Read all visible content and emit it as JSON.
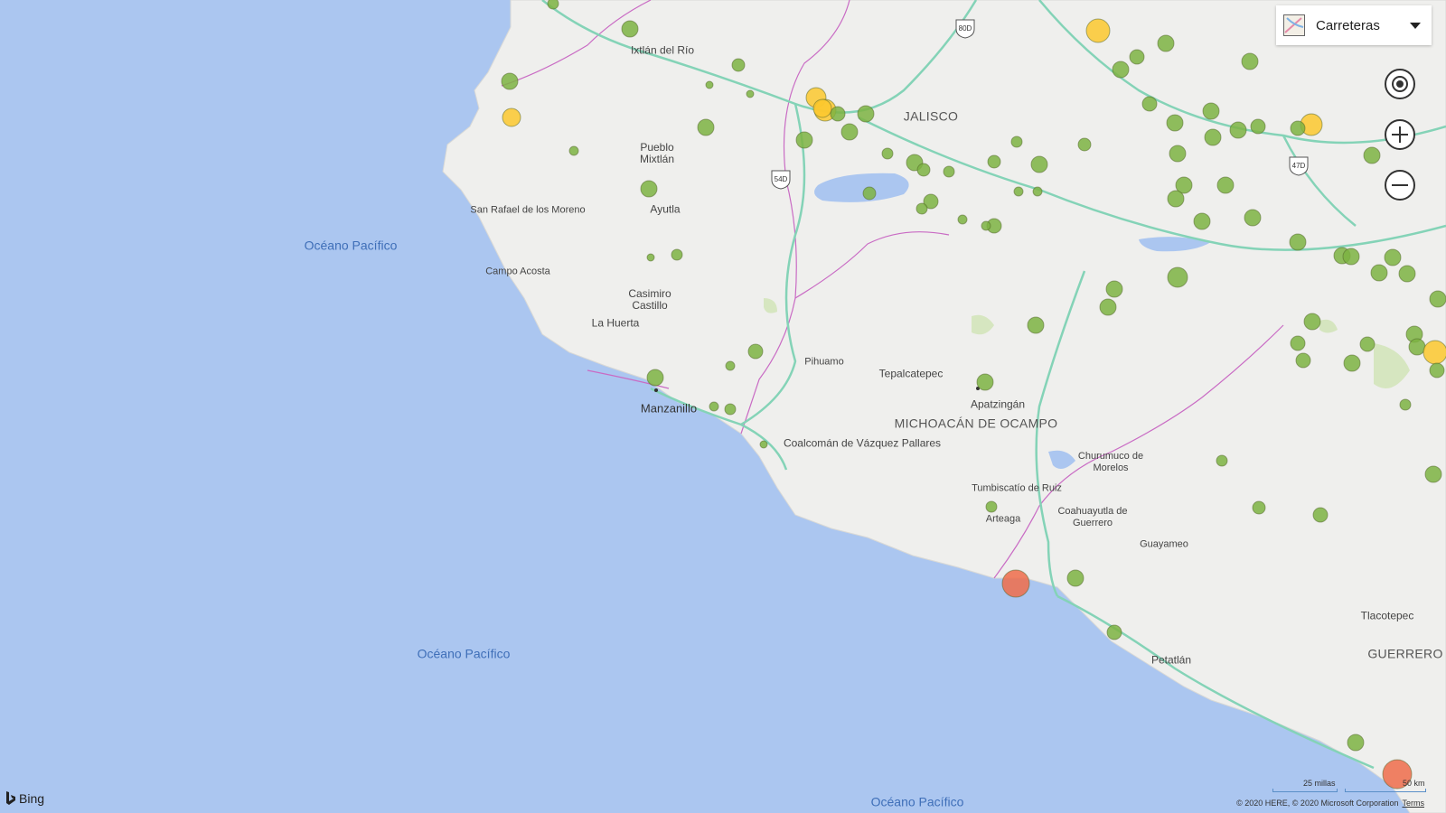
{
  "map": {
    "ocean_labels": [
      "Océano Pacífico",
      "Océano Pacífico",
      "Océano Pacífico"
    ],
    "state_labels": [
      "JALISCO",
      "MICHOACÁN DE OCAMPO",
      "GUERRERO"
    ],
    "place_labels": [
      "Ixtlán del Río",
      "Pueblo Mixtlán",
      "Ayutla",
      "San Rafael de los Moreno",
      "Campo Acosta",
      "Casimiro Castillo",
      "La Huerta",
      "Manzanillo",
      "Pihuamo",
      "Tepalcatepec",
      "Apatzingán",
      "Coalcomán de Vázquez Pallares",
      "Churumuco de Morelos",
      "Tumbiscatío de Ruiz",
      "Arteaga",
      "Coahuayutla de Guerrero",
      "Guayameo",
      "Petatlán",
      "Tlacotepec"
    ],
    "highway_shields": [
      "80D",
      "54D",
      "47D"
    ],
    "colors": {
      "water": "#abc6f0",
      "land": "#efefed",
      "road": "#84d3b7",
      "border": "#c96bc4",
      "green": "#7cb342",
      "yellow": "#fbc82e",
      "red": "#ef6c4a"
    }
  },
  "controls": {
    "style_label": "Carreteras",
    "locate_icon": "target-icon",
    "zoom_in_icon": "plus-icon",
    "zoom_out_icon": "minus-icon"
  },
  "footer": {
    "bing": "Bing",
    "scale_miles": "25 millas",
    "scale_km": "50 km",
    "copyright": "© 2020 HERE, © 2020 Microsoft Corporation",
    "terms": "Terms"
  }
}
